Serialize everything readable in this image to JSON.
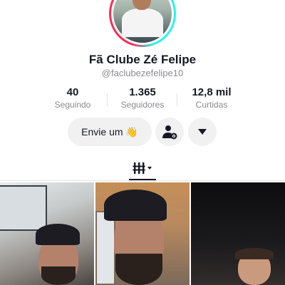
{
  "profile": {
    "display_name": "Fã Clube Zé Felipe",
    "username": "@faclubezefelipe10"
  },
  "stats": [
    {
      "value": "40",
      "label": "Seguindo"
    },
    {
      "value": "1.365",
      "label": "Seguidores"
    },
    {
      "value": "12,8 mil",
      "label": "Curtidas"
    }
  ],
  "actions": {
    "message_label": "Envie um 👋",
    "add_friend_icon": "person-gear-icon",
    "more_icon": "caret-down-icon"
  },
  "tabs": {
    "videos_icon": "grid-icon"
  },
  "colors": {
    "ring_cyan": "#25f4ee",
    "ring_red": "#fe2c55",
    "button_bg": "#f1f1f2",
    "text_primary": "#161823",
    "text_secondary": "#8a8b91"
  }
}
